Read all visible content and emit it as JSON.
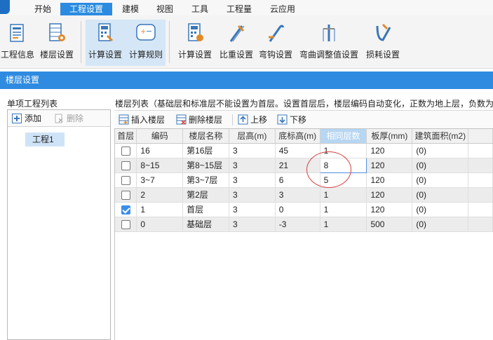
{
  "menu": {
    "tabs": [
      {
        "label": "开始"
      },
      {
        "label": "工程设置"
      },
      {
        "label": "建模"
      },
      {
        "label": "视图"
      },
      {
        "label": "工具"
      },
      {
        "label": "工程量"
      },
      {
        "label": "云应用"
      }
    ],
    "active_index": 1
  },
  "ribbon": {
    "buttons": [
      {
        "label": "工程信息",
        "icon": "project-info-icon"
      },
      {
        "label": "楼层设置",
        "icon": "floor-settings-icon"
      },
      {
        "label": "计算设置",
        "icon": "calc-settings-icon"
      },
      {
        "label": "计算规则",
        "icon": "calc-rules-icon"
      },
      {
        "label": "计算设置",
        "icon": "rebar-calc-settings-icon"
      },
      {
        "label": "比重设置",
        "icon": "density-settings-icon"
      },
      {
        "label": "弯钩设置",
        "icon": "hook-settings-icon"
      },
      {
        "label": "弯曲调整值设置",
        "icon": "bend-adjust-icon"
      },
      {
        "label": "损耗设置",
        "icon": "loss-settings-icon"
      }
    ]
  },
  "panel": {
    "title": "楼层设置"
  },
  "left": {
    "title": "单项工程列表",
    "add_label": "添加",
    "delete_label": "删除",
    "projects": [
      "工程1"
    ]
  },
  "right": {
    "title": "楼层列表（基础层和标准层不能设置为首层。设置首层后，楼层编码自动变化，正数为地上层，负数为",
    "toolbar": {
      "insert_label": "插入楼层",
      "delete_label": "删除楼层",
      "up_label": "上移",
      "down_label": "下移"
    }
  },
  "table": {
    "headers": [
      "首层",
      "编码",
      "楼层名称",
      "层高(m)",
      "底标高(m)",
      "相同层数",
      "板厚(mm)",
      "建筑面积(m2)"
    ],
    "highlighted_header": 5,
    "rows": [
      {
        "first": false,
        "code": "16",
        "name": "第16层",
        "height": "3",
        "bottom": "45",
        "same": "1",
        "slab": "120",
        "area": "(0)"
      },
      {
        "first": false,
        "code": "8~15",
        "name": "第8~15层",
        "height": "3",
        "bottom": "21",
        "same": "8",
        "slab": "120",
        "area": "(0)"
      },
      {
        "first": false,
        "code": "3~7",
        "name": "第3~7层",
        "height": "3",
        "bottom": "6",
        "same": "5",
        "slab": "120",
        "area": "(0)"
      },
      {
        "first": false,
        "code": "2",
        "name": "第2层",
        "height": "3",
        "bottom": "3",
        "same": "1",
        "slab": "120",
        "area": "(0)"
      },
      {
        "first": true,
        "code": "1",
        "name": "首层",
        "height": "3",
        "bottom": "0",
        "same": "1",
        "slab": "120",
        "area": "(0)"
      },
      {
        "first": false,
        "code": "0",
        "name": "基础层",
        "height": "3",
        "bottom": "-3",
        "same": "1",
        "slab": "500",
        "area": "(0)"
      }
    ],
    "editing_row": 1
  },
  "colors": {
    "accent": "#2f8be0",
    "ribbon_selected": "#d5e7f6",
    "annotation": "#d94040"
  }
}
